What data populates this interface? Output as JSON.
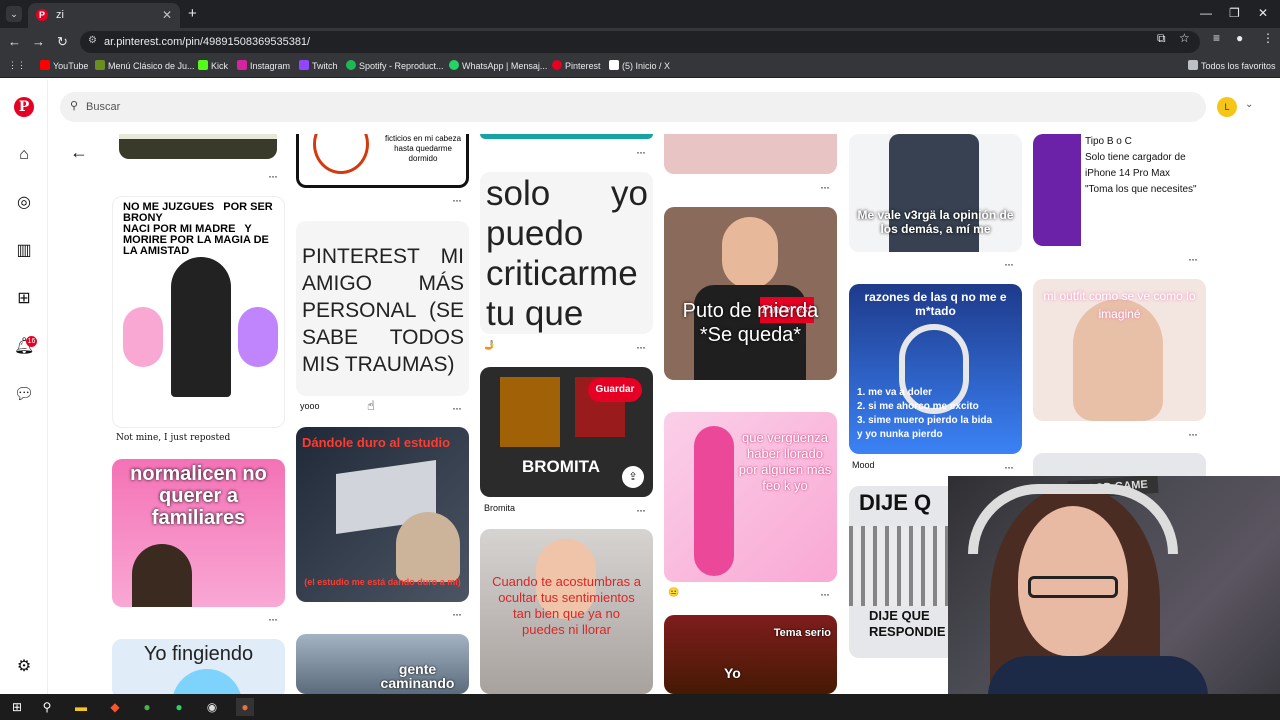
{
  "browser": {
    "tab_title": "zi",
    "tab_favicon": "P",
    "url": "ar.pinterest.com/pin/498915083695353​81/",
    "bookmarks": [
      "YouTube",
      "Menú Clásico de Ju...",
      "Kick",
      "Instagram",
      "Twitch",
      "Spotify - Reproduct...",
      "WhatsApp | Mensaj...",
      "Pinterest",
      "(5) Inicio / X"
    ],
    "all_bookmarks": "Todos los favoritos"
  },
  "pinterest": {
    "search_placeholder": "Buscar",
    "avatar_letter": "L",
    "notification_count": "16",
    "pins": {
      "p1": "",
      "p2": "NO ME JUZGUES   POR SER BRONY\nNACI POR MI MADRE   Y MORIRE POR LA MAGIA DE LA AMISTAD",
      "p2_caption": "Not mine, I just reposted",
      "p3": "normalicen no querer a familiares",
      "p4": "Yo fingiendo",
      "p5": "ficticios en mi cabeza hasta quedarme dormido",
      "p6": "PINTEREST MI AMIGO MÁS PERSONAL (SE SABE TODOS MIS TRAUMAS)",
      "p6_caption": "yooo",
      "p7": "Dándole duro al estudio",
      "p7_sub": "(el estudio me está dando duro a mí)",
      "p8": "gente caminando",
      "p9": "solo yo puedo criticarme tu que",
      "p10": "BROMITA",
      "p10_caption": "Bromita",
      "p11": "Cuando te acostumbras a ocultar tus sentimientos tan bien que ya no puedes ni llorar",
      "p12": "Puto de mierda *Se queda*",
      "p13": "que vergüenza haber llorado por alguien más feo k yo",
      "p14_top": "Tema serio",
      "p14_bottom": "Yo",
      "p15": "Me vale v3rgä la opinión de los demás, a mí me",
      "p16": "razones de las q no me e m*tado",
      "p16_list": "1. me va a doler\n2. si me ahorco me excito\n3. sime muero pierdo la bida\ny yo nunka pierdo",
      "p16_caption": "Mood",
      "p17": "DIJE Q",
      "p17_bottom": "DIJE QUE RESPONDIE",
      "p18": "Tipo B o C\nSolo tiene cargador de iPhone 14 Pro Max\n\"Toma los que necesites\"",
      "p19": "mi outfit como se ve como lo imaginé",
      "p20": "GOOD GAME"
    },
    "save_label": "Guardar"
  },
  "colors": {
    "pinterest_red": "#e60023"
  }
}
